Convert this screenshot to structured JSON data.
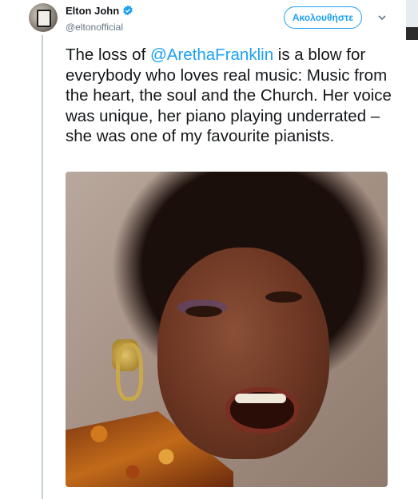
{
  "tweet": {
    "display_name": "Elton John",
    "handle": "@eltonofficial",
    "follow_label": "Ακολουθήστε",
    "text_before": "The loss of ",
    "mention": "@ArethaFranklin",
    "text_after": " is a blow for everybody who loves real music: Music from the heart, the soul and the Church. Her voice was unique, her piano playing underrated – she was one of my favourite pianists.",
    "verified": true
  },
  "icons": {
    "verified": "verified-badge-icon",
    "menu": "chevron-down-icon"
  },
  "colors": {
    "accent": "#1da1f2",
    "text": "#14171a",
    "secondary": "#657786"
  }
}
